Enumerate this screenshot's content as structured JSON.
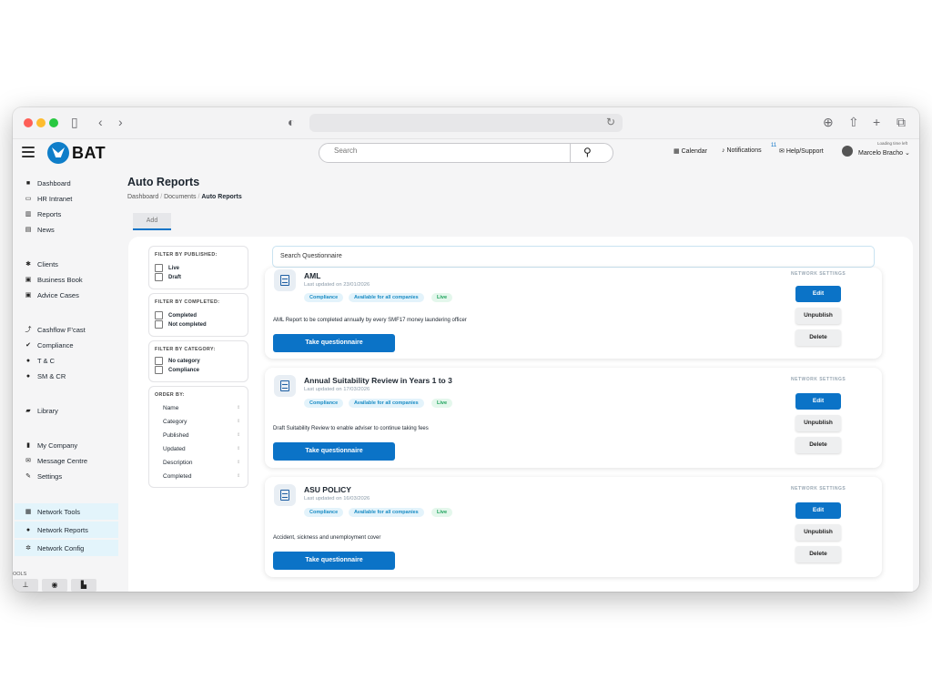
{
  "colors": {
    "accent": "#0b73c7",
    "compliance_tag": "#e3f3fb",
    "live_tag": "#e4f7ec",
    "sidebar_highlight": "#e3f4fb"
  },
  "browser": {
    "icons": [
      "sidebar-icon",
      "back-icon",
      "forward-icon",
      "shield-icon",
      "reload-icon",
      "download-icon",
      "share-icon",
      "new-tab-icon",
      "tabs-icon"
    ]
  },
  "header": {
    "logo_text": "BAT",
    "search_placeholder": "Search",
    "calendar": "Calendar",
    "notifications": "Notifications",
    "notifications_count": "11",
    "help": "Help/Support",
    "loading_time": "Loading time left",
    "user_name": "Marcelo Bracho"
  },
  "sidebar": {
    "group1": [
      {
        "label": "Dashboard",
        "icon": "grid-icon",
        "glyph": "■"
      },
      {
        "label": "HR Intranet",
        "icon": "monitor-icon",
        "glyph": "▭"
      },
      {
        "label": "Reports",
        "icon": "bar-chart-icon",
        "glyph": "▥"
      },
      {
        "label": "News",
        "icon": "newspaper-icon",
        "glyph": "▤"
      }
    ],
    "group2": [
      {
        "label": "Clients",
        "icon": "users-icon",
        "glyph": "✱"
      },
      {
        "label": "Business Book",
        "icon": "book-icon",
        "glyph": "▣"
      },
      {
        "label": "Advice Cases",
        "icon": "folder-icon",
        "glyph": "▣"
      }
    ],
    "group3": [
      {
        "label": "Cashflow F'cast",
        "icon": "line-chart-icon",
        "glyph": "⤴"
      },
      {
        "label": "Compliance",
        "icon": "check-icon",
        "glyph": "✔"
      },
      {
        "label": "T & C",
        "icon": "question-icon",
        "glyph": "●"
      },
      {
        "label": "SM & CR",
        "icon": "question-icon",
        "glyph": "●"
      }
    ],
    "group4": [
      {
        "label": "Library",
        "icon": "book-icon",
        "glyph": "▰"
      }
    ],
    "group5": [
      {
        "label": "My Company",
        "icon": "building-icon",
        "glyph": "▮"
      },
      {
        "label": "Message Centre",
        "icon": "envelope-icon",
        "glyph": "✉"
      },
      {
        "label": "Settings",
        "icon": "wrench-icon",
        "glyph": "✎"
      }
    ],
    "group6": [
      {
        "label": "Network Tools",
        "icon": "grid-icon",
        "glyph": "▦"
      },
      {
        "label": "Network Reports",
        "icon": "info-icon",
        "glyph": "●"
      },
      {
        "label": "Network Config",
        "icon": "gear-icon",
        "glyph": "✲"
      }
    ],
    "tools_label": "OOLS"
  },
  "page": {
    "title": "Auto Reports",
    "breadcrumb": {
      "home": "Dashboard",
      "mid": "Documents",
      "current": "Auto Reports",
      "sep": "/"
    },
    "add_label": "Add"
  },
  "filters": {
    "published": {
      "title": "FILTER BY PUBLISHED:",
      "options": [
        "Live",
        "Draft"
      ]
    },
    "completed": {
      "title": "FILTER BY COMPLETED:",
      "options": [
        "Completed",
        "Not completed"
      ]
    },
    "category": {
      "title": "FILTER BY CATEGORY:",
      "options": [
        "No category",
        "Compliance"
      ]
    },
    "order": {
      "title": "ORDER BY:",
      "options": [
        "Name",
        "Category",
        "Published",
        "Updated",
        "Description",
        "Completed"
      ]
    }
  },
  "questionnaire_search": "Search Questionnaire",
  "cards": [
    {
      "title": "AML",
      "updated": "Last updated on 23/01/2026",
      "tags": [
        "Compliance",
        "Available for all companies",
        "Live"
      ],
      "description": "AML Report to be completed annually by every SMF17 money laundering officer",
      "take": "Take questionnaire",
      "network": "NETWORK SETTINGS",
      "edit": "Edit",
      "unpublish": "Unpublish",
      "delete": "Delete"
    },
    {
      "title": "Annual Suitability Review in Years 1 to 3",
      "updated": "Last updated on 17/03/2026",
      "tags": [
        "Compliance",
        "Available for all companies",
        "Live"
      ],
      "description": "Draft Suitability Review to enable adviser to continue taking fees",
      "take": "Take questionnaire",
      "network": "NETWORK SETTINGS",
      "edit": "Edit",
      "unpublish": "Unpublish",
      "delete": "Delete"
    },
    {
      "title": "ASU POLICY",
      "updated": "Last updated on 16/03/2026",
      "tags": [
        "Compliance",
        "Available for all companies",
        "Live"
      ],
      "description": "Accident, sickness and unemployment cover",
      "take": "Take questionnaire",
      "network": "NETWORK SETTINGS",
      "edit": "Edit",
      "unpublish": "Unpublish",
      "delete": "Delete"
    }
  ]
}
